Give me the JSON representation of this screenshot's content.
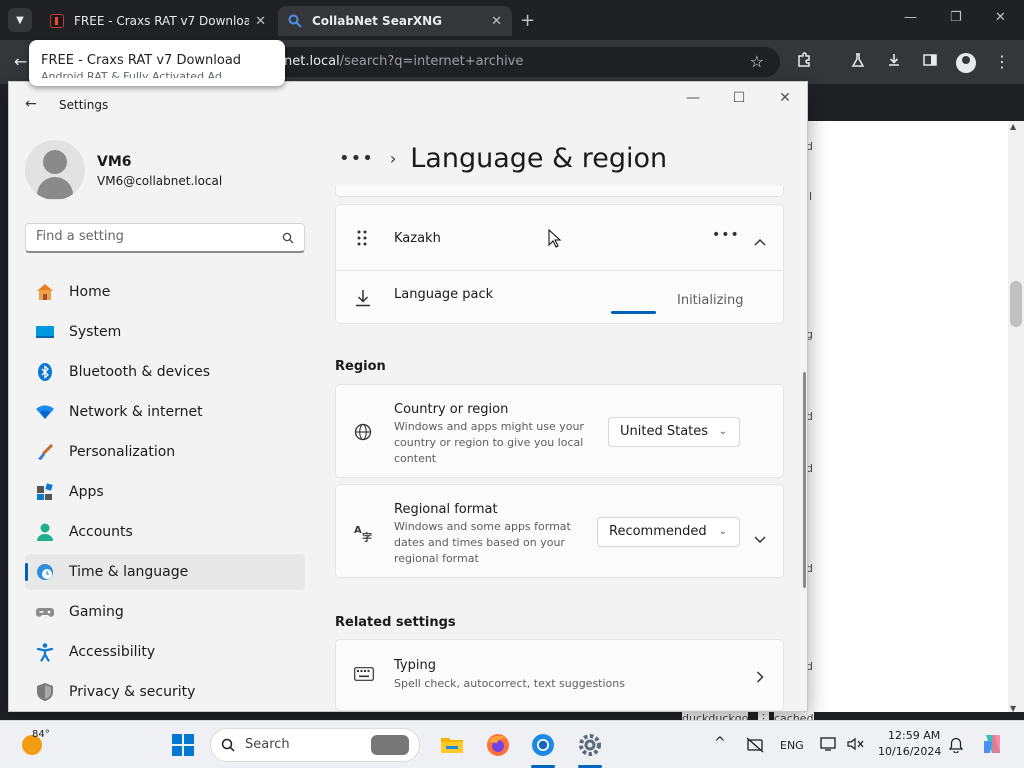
{
  "browser": {
    "tabs": [
      {
        "title": "FREE - Craxs RAT v7 Download"
      },
      {
        "title": "CollabNet SearXNG"
      }
    ],
    "hover_card": {
      "title": "FREE - Craxs RAT v7 Download",
      "line2": "Android RAT & Fully Activated Ad"
    },
    "address_host": "net.local",
    "address_path": "/search?q=internet+archive",
    "bottom_fragments": [
      "duckduckgo",
      "cached"
    ],
    "side_fragments": [
      "d",
      "ll",
      "l",
      "g",
      "d",
      "d",
      "d",
      "d"
    ]
  },
  "settings": {
    "window_title": "Settings",
    "user": {
      "name": "VM6",
      "email": "VM6@collabnet.local"
    },
    "search_placeholder": "Find a setting",
    "nav": [
      {
        "label": "Home",
        "icon": "home-icon"
      },
      {
        "label": "System",
        "icon": "system-icon"
      },
      {
        "label": "Bluetooth & devices",
        "icon": "bluetooth-icon"
      },
      {
        "label": "Network & internet",
        "icon": "network-icon"
      },
      {
        "label": "Personalization",
        "icon": "brush-icon"
      },
      {
        "label": "Apps",
        "icon": "apps-icon"
      },
      {
        "label": "Accounts",
        "icon": "accounts-icon"
      },
      {
        "label": "Time & language",
        "icon": "time-language-icon",
        "selected": true
      },
      {
        "label": "Gaming",
        "icon": "gaming-icon"
      },
      {
        "label": "Accessibility",
        "icon": "accessibility-icon"
      },
      {
        "label": "Privacy & security",
        "icon": "shield-icon"
      }
    ],
    "breadcrumb": {
      "dots": "•••",
      "title": "Language & region"
    },
    "language": {
      "name": "Kazakh",
      "pack_label": "Language pack",
      "pack_status": "Initializing",
      "pack_progress": 0.3
    },
    "region": {
      "title": "Region",
      "country": {
        "title": "Country or region",
        "subtitle": "Windows and apps might use your country or region to give you local content",
        "value": "United States"
      },
      "format": {
        "title": "Regional format",
        "subtitle": "Windows and some apps format dates and times based on your regional format",
        "value": "Recommended"
      }
    },
    "related": {
      "title": "Related settings",
      "typing": {
        "title": "Typing",
        "subtitle": "Spell check, autocorrect, text suggestions"
      }
    }
  },
  "taskbar": {
    "temperature": "84°",
    "search_label": "Search",
    "lang": "ENG",
    "time": "12:59 AM",
    "date": "10/16/2024"
  },
  "colors": {
    "accent": "#005fb8",
    "chrome_dark": "#202124",
    "settings_bg": "#f3f3f3"
  }
}
